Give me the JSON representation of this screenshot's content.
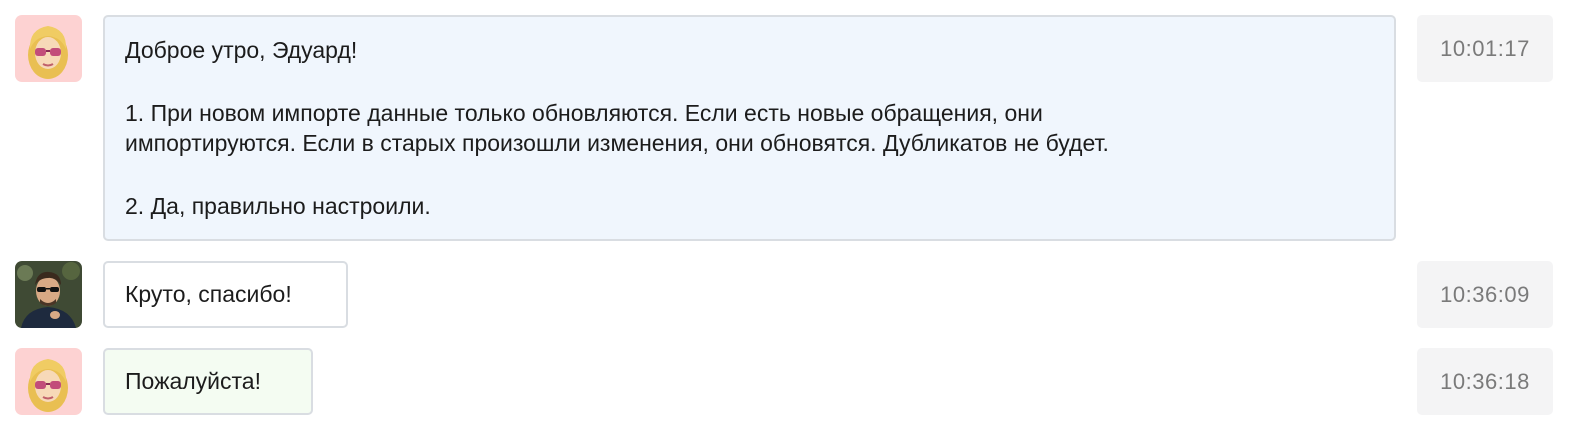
{
  "messages": [
    {
      "author_role": "agent",
      "avatar_icon": "memoji-woman-sunglasses-icon",
      "paragraphs": [
        "Доброе утро, Эдуард!",
        "1. При новом импорте данные только обновляются. Если есть новые обращения, они\nимпортируются. Если в старых произошли изменения, они обновятся. Дубликатов не будет.",
        "2. Да, правильно настроили."
      ],
      "time": "10:01:17",
      "bubble_color": "#f0f6fd"
    },
    {
      "author_role": "client",
      "avatar_icon": "man-sunglasses-photo-icon",
      "paragraphs": [
        "Круто, спасибо!"
      ],
      "time": "10:36:09",
      "bubble_color": "#ffffff"
    },
    {
      "author_role": "agent",
      "avatar_icon": "memoji-woman-sunglasses-icon",
      "paragraphs": [
        "Пожалуйста!"
      ],
      "time": "10:36:18",
      "bubble_color": "#f4fcf2"
    }
  ]
}
